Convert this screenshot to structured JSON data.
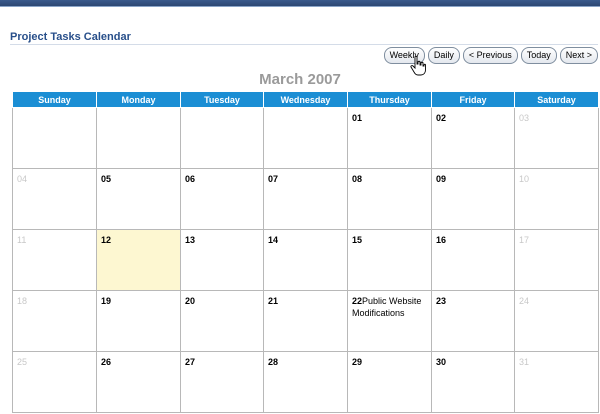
{
  "region": {
    "title": "Project Tasks Calendar"
  },
  "toolbar": {
    "weekly": "Weekly",
    "daily": "Daily",
    "previous": "< Previous",
    "today": "Today",
    "next": "Next >"
  },
  "calendar": {
    "month_title": "March 2007",
    "weekdays": [
      "Sunday",
      "Monday",
      "Tuesday",
      "Wednesday",
      "Thursday",
      "Friday",
      "Saturday"
    ],
    "weeks": [
      [
        "",
        "",
        "",
        "",
        "01",
        "02",
        "03"
      ],
      [
        "04",
        "05",
        "06",
        "07",
        "08",
        "09",
        "10"
      ],
      [
        "11",
        "12",
        "13",
        "14",
        "15",
        "16",
        "17"
      ],
      [
        "18",
        "19",
        "20",
        "21",
        "22",
        "23",
        "24"
      ],
      [
        "25",
        "26",
        "27",
        "28",
        "29",
        "30",
        "31"
      ]
    ],
    "today": "12",
    "events": [
      {
        "day": "22",
        "text": "Public Website Modifications"
      }
    ]
  },
  "colors": {
    "header_bg": "#1b8ed4",
    "title": "#284f8a",
    "today_bg": "#fdf7d1",
    "muted_day": "#c8c8c8"
  },
  "icons": {
    "cursor": "hand-pointer-icon"
  }
}
